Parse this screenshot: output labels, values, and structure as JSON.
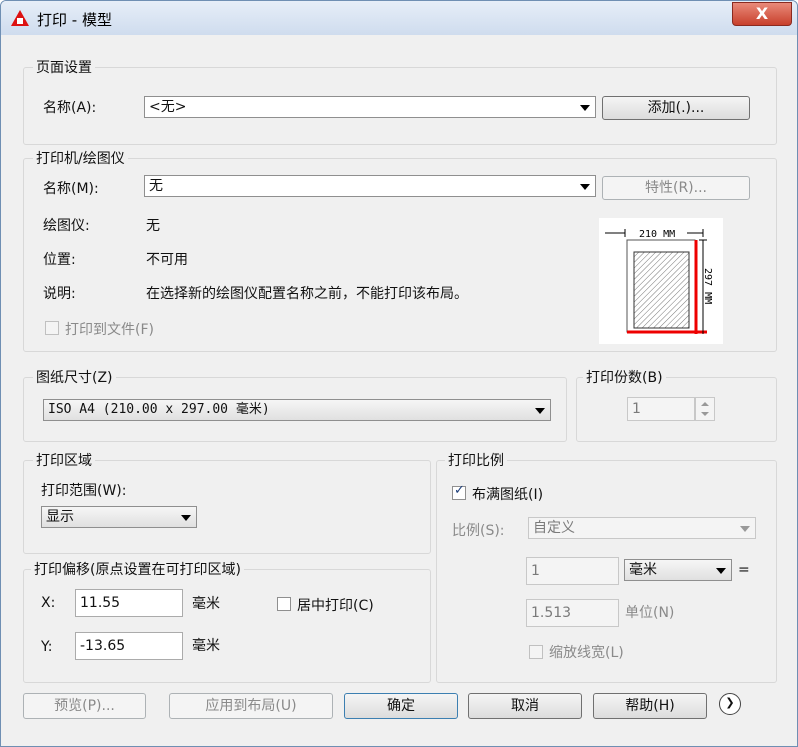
{
  "window": {
    "title": "打印 - 模型",
    "close_label": "X"
  },
  "page_setup": {
    "legend": "页面设置",
    "name_label": "名称(A):",
    "name_value": "<无>",
    "add_button": "添加(.)..."
  },
  "printer": {
    "legend": "打印机/绘图仪",
    "name_label": "名称(M):",
    "name_value": "无",
    "properties_button": "特性(R)...",
    "plotter_label": "绘图仪:",
    "plotter_value": "无",
    "location_label": "位置:",
    "location_value": "不可用",
    "description_label": "说明:",
    "description_value": "在选择新的绘图仪配置名称之前，不能打印该布局。",
    "print_to_file_label": "打印到文件(F)",
    "preview_width": "210 MM",
    "preview_height": "297 MM"
  },
  "paper_size": {
    "legend": "图纸尺寸(Z)",
    "value": "ISO A4 (210.00 x 297.00 毫米)"
  },
  "copies": {
    "legend": "打印份数(B)",
    "value": "1"
  },
  "plot_area": {
    "legend": "打印区域",
    "range_label": "打印范围(W):",
    "range_value": "显示"
  },
  "plot_offset": {
    "legend": "打印偏移(原点设置在可打印区域)",
    "x_label": "X:",
    "x_value": "11.55",
    "x_unit": "毫米",
    "y_label": "Y:",
    "y_value": "-13.65",
    "y_unit": "毫米",
    "center_label": "居中打印(C)"
  },
  "plot_scale": {
    "legend": "打印比例",
    "fit_label": "布满图纸(I)",
    "scale_label": "比例(S):",
    "scale_value": "自定义",
    "value1": "1",
    "unit_value": "毫米",
    "equals": "=",
    "value2": "1.513",
    "unit2_label": "单位(N)",
    "lineweights_label": "缩放线宽(L)"
  },
  "footer": {
    "preview_button": "预览(P)...",
    "apply_layout_button": "应用到布局(U)",
    "ok_button": "确定",
    "cancel_button": "取消",
    "help_button": "帮助(H)",
    "more_icon": "❯"
  }
}
